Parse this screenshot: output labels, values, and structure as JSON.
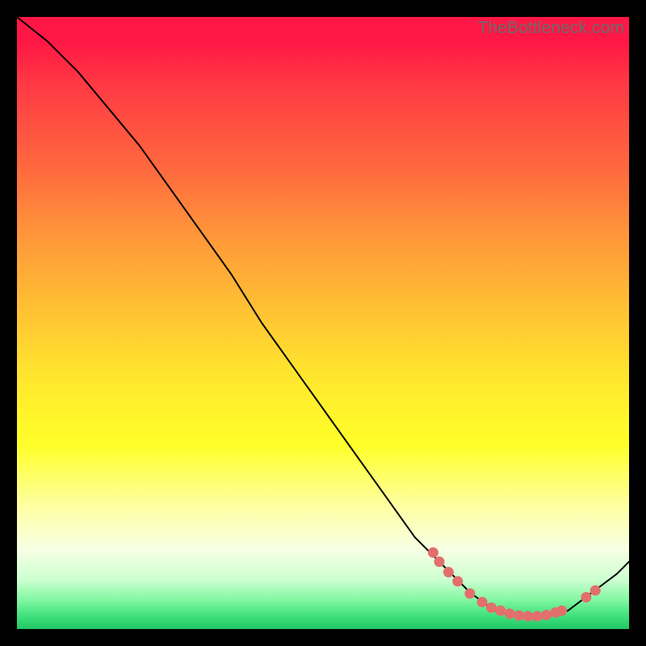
{
  "watermark": "TheBottleneck.com",
  "colors": {
    "dot": "#e26f6d",
    "line": "#000000",
    "background": "#000000"
  },
  "chart_data": {
    "type": "line",
    "title": "",
    "xlabel": "",
    "ylabel": "",
    "xlim": [
      0,
      100
    ],
    "ylim": [
      0,
      100
    ],
    "grid": false,
    "legend": false,
    "curve": [
      {
        "x": 0,
        "y": 100
      },
      {
        "x": 5,
        "y": 96
      },
      {
        "x": 10,
        "y": 91
      },
      {
        "x": 15,
        "y": 85
      },
      {
        "x": 20,
        "y": 79
      },
      {
        "x": 25,
        "y": 72
      },
      {
        "x": 30,
        "y": 65
      },
      {
        "x": 35,
        "y": 58
      },
      {
        "x": 40,
        "y": 50
      },
      {
        "x": 45,
        "y": 43
      },
      {
        "x": 50,
        "y": 36
      },
      {
        "x": 55,
        "y": 29
      },
      {
        "x": 60,
        "y": 22
      },
      {
        "x": 65,
        "y": 15
      },
      {
        "x": 70,
        "y": 10
      },
      {
        "x": 74,
        "y": 6
      },
      {
        "x": 78,
        "y": 3
      },
      {
        "x": 82,
        "y": 2
      },
      {
        "x": 86,
        "y": 2
      },
      {
        "x": 90,
        "y": 3
      },
      {
        "x": 94,
        "y": 6
      },
      {
        "x": 98,
        "y": 9
      },
      {
        "x": 100,
        "y": 11
      }
    ],
    "highlight_points": [
      {
        "x": 68,
        "y": 12.5
      },
      {
        "x": 69,
        "y": 11.0
      },
      {
        "x": 70.5,
        "y": 9.3
      },
      {
        "x": 72,
        "y": 7.8
      },
      {
        "x": 74,
        "y": 5.8
      },
      {
        "x": 76,
        "y": 4.4
      },
      {
        "x": 77.5,
        "y": 3.5
      },
      {
        "x": 79,
        "y": 3.0
      },
      {
        "x": 80.5,
        "y": 2.5
      },
      {
        "x": 82,
        "y": 2.2
      },
      {
        "x": 83.5,
        "y": 2.1
      },
      {
        "x": 85,
        "y": 2.1
      },
      {
        "x": 86.5,
        "y": 2.3
      },
      {
        "x": 88,
        "y": 2.7
      },
      {
        "x": 89,
        "y": 3.0
      },
      {
        "x": 93,
        "y": 5.2
      },
      {
        "x": 94.5,
        "y": 6.3
      }
    ]
  }
}
